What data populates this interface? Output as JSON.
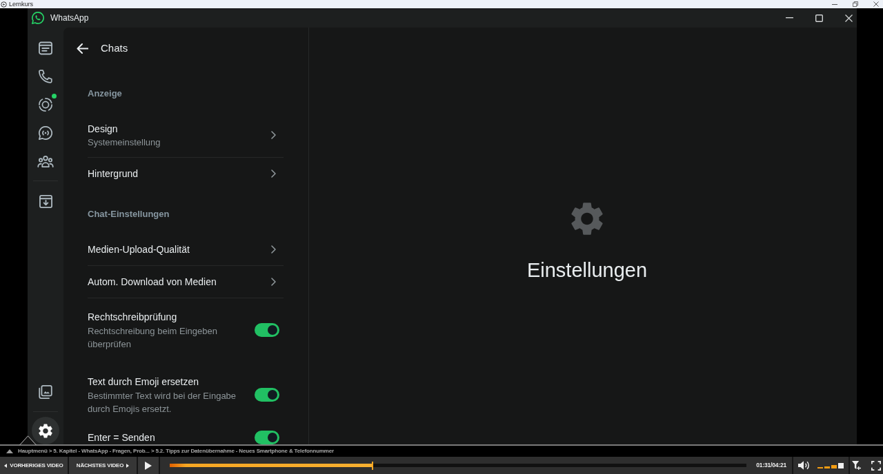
{
  "os_window": {
    "title": "Lernkurs"
  },
  "app_window": {
    "title": "WhatsApp"
  },
  "nav_rail": {
    "main": [
      {
        "selected": false,
        "new_updates": false
      },
      {
        "selected": false,
        "new_updates": false
      },
      {
        "selected": false,
        "new_updates": true
      },
      {
        "selected": false,
        "new_updates": false
      },
      {
        "selected": false,
        "new_updates": false
      }
    ],
    "archive": {
      "selected": false
    },
    "media": {
      "selected": false
    },
    "settings": {
      "selected": true
    }
  },
  "settings_panel": {
    "title": "Chats",
    "sections": [
      {
        "heading": "Anzeige",
        "items": [
          {
            "kind": "link",
            "title": "Design",
            "subtitle": "Systemeinstellung"
          },
          {
            "kind": "link",
            "title": "Hintergrund"
          }
        ]
      },
      {
        "heading": "Chat-Einstellungen",
        "items": [
          {
            "kind": "link",
            "title": "Medien-Upload-Qualität"
          },
          {
            "kind": "link",
            "title": "Autom. Download von Medien"
          },
          {
            "kind": "toggle",
            "title": "Rechtschreibprüfung",
            "subtitle": "Rechtschreibung beim Eingeben überprüfen",
            "on": true
          },
          {
            "kind": "toggle",
            "title": "Text durch Emoji ersetzen",
            "subtitle": "Bestimmter Text wird bei der Eingabe durch Emojis ersetzt.",
            "on": true
          },
          {
            "kind": "toggle",
            "title": "Enter = Senden",
            "on": true
          }
        ]
      }
    ]
  },
  "detail": {
    "title": "Einstellungen"
  },
  "player": {
    "breadcrumb": "Hauptmenü > 5. Kapitel - WhatsApp - Fragen, Prob... > 5.2. Tipps zur Datenübernahme - Neues Smartphone & Telefonnummer",
    "previous_button": "VORHERIGES VIDEO",
    "next_button": "NÄCHSTES VIDEO",
    "progress": {
      "level": 0.35
    },
    "time": "01:31/04:21",
    "volume": {
      "level": 0.75
    }
  }
}
